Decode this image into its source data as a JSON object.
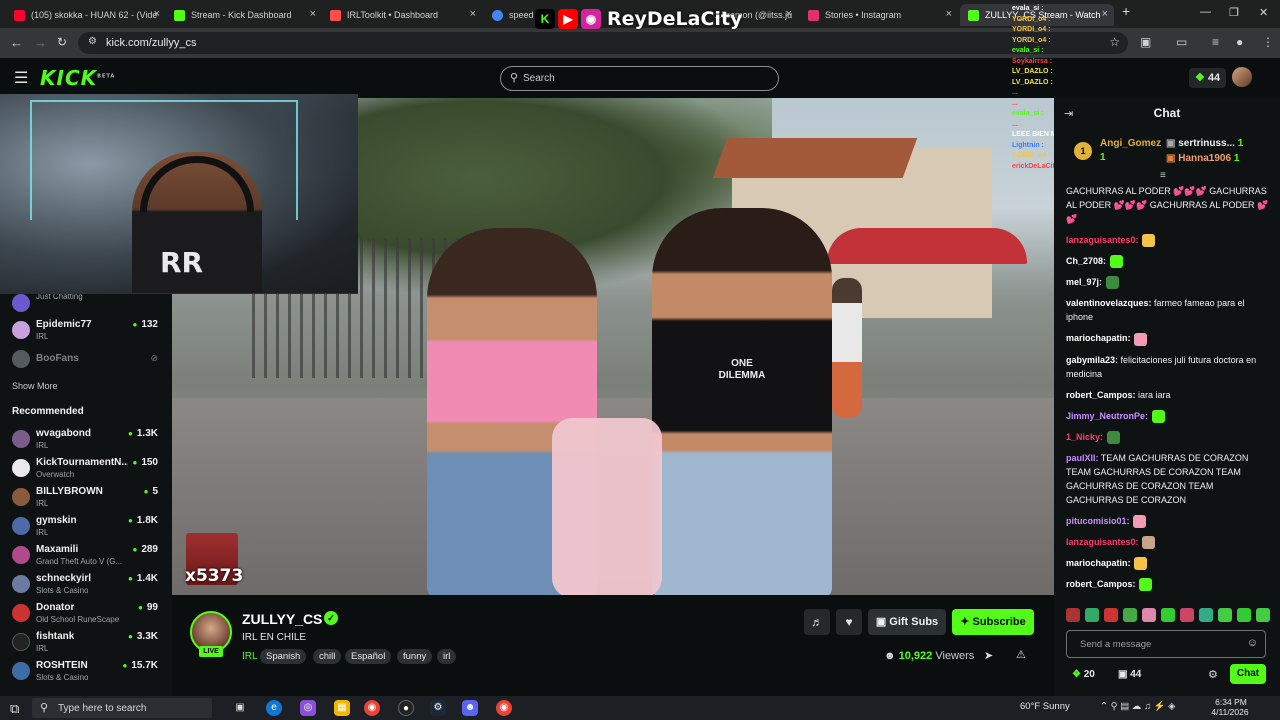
{
  "browser": {
    "tabs": [
      {
        "title": "(105) skokka - HUAN 62 - (Vide",
        "icon_color": "#ff0033"
      },
      {
        "title": "Stream - Kick Dashboard",
        "icon_color": "#53fc18"
      },
      {
        "title": "IRLToolkit • Dashboard",
        "icon_color": "#ff4d4d"
      },
      {
        "title": "speed t",
        "icon_color": "#4285f4"
      },
      {
        "title": "...lizamon (@iitss.ju",
        "icon_color": "#e1306c"
      },
      {
        "title": "Stories • Instagram",
        "icon_color": "#e1306c"
      },
      {
        "title": "ZULLYY_CS Stream - Watch",
        "icon_color": "#53fc18"
      }
    ],
    "url": "kick.com/zullyy_cs",
    "new_tab": "+",
    "close": "×"
  },
  "overlay": {
    "channel_name": "ReyDeLaCity",
    "chat_lines": [
      {
        "text": "evala_si :",
        "color": "#ffffff"
      },
      {
        "text": "YORDI_o4 :",
        "color": "#f5c542"
      },
      {
        "text": "YORDI_o4 :",
        "color": "#f5c542"
      },
      {
        "text": "YORDI_o4 :",
        "color": "#f5c542"
      },
      {
        "text": "evala_si :",
        "color": "#53fc18"
      },
      {
        "text": "Soykalrrsa :",
        "color": "#ff4040"
      },
      {
        "text": "LV_DAZLO :",
        "color": "#f5e642"
      },
      {
        "text": "LV_DAZLO :",
        "color": "#f5e642"
      },
      {
        "text": "...",
        "color": "#ff4040"
      },
      {
        "text": "...",
        "color": "#ff4040"
      },
      {
        "text": "evala_si :",
        "color": "#53fc18"
      },
      {
        "text": "...",
        "color": "#ff4040"
      },
      {
        "text": "LEEE BIEN MMG",
        "color": "#ffffff"
      },
      {
        "text": "Lightnin :",
        "color": "#3a7bff"
      },
      {
        "text": "YORDI_o4 :",
        "color": "#f5c542"
      },
      {
        "text": "erickDeLaCity :",
        "color": "#ff4040"
      }
    ]
  },
  "header": {
    "logo": "KICK",
    "logo_sup": "BETA",
    "search_placeholder": "Search",
    "points": "44"
  },
  "sidebar": {
    "following": [
      {
        "name": "Just Chatting",
        "category": "",
        "viewers": "",
        "avatar": "#6a5acd"
      },
      {
        "name": "Epidemic77",
        "category": "IRL",
        "viewers": "132",
        "avatar": "#c9a0dc"
      },
      {
        "name": "BooFans",
        "category": "",
        "viewers": "",
        "avatar": "#555a5e"
      }
    ],
    "show_more": "Show More",
    "recommended_heading": "Recommended",
    "recommended": [
      {
        "name": "wvagabond",
        "category": "IRL",
        "viewers": "1.3K",
        "avatar": "#7b5a8c"
      },
      {
        "name": "KickTournamentN...",
        "category": "Overwatch",
        "viewers": "150",
        "avatar": "#eaeaea"
      },
      {
        "name": "BILLYBROWN",
        "category": "IRL",
        "viewers": "5",
        "avatar": "#8a5a3c"
      },
      {
        "name": "gymskin",
        "category": "IRL",
        "viewers": "1.8K",
        "avatar": "#4a6aa8"
      },
      {
        "name": "Maxamili",
        "category": "Grand Theft Auto V (G...",
        "viewers": "289",
        "avatar": "#b04a8a"
      },
      {
        "name": "schneckyirl",
        "category": "Slots & Casino",
        "viewers": "1.4K",
        "avatar": "#6a7aa0"
      },
      {
        "name": "Donator",
        "category": "Old School RuneScape",
        "viewers": "99",
        "avatar": "#c33"
      },
      {
        "name": "fishtank",
        "category": "IRL",
        "viewers": "3.3K",
        "avatar": "#222"
      },
      {
        "name": "ROSHTEIN",
        "category": "Slots & Casino",
        "viewers": "15.7K",
        "avatar": "#3b6ea5"
      }
    ]
  },
  "video": {
    "shirt_text": "ONE DILEMMA",
    "emote_count": "x5373"
  },
  "stream": {
    "streamer": "ZULLYY_CS",
    "live": "LIVE",
    "title": "IRL EN CHILE",
    "category": "IRL",
    "tags": [
      "Spanish",
      "chill",
      "Español",
      "funny",
      "irl"
    ],
    "gift_subs": "Gift Subs",
    "subscribe": "Subscribe",
    "viewers": "10,922",
    "viewers_label": "Viewers"
  },
  "chat": {
    "title": "Chat",
    "gifters": [
      {
        "rank": "1",
        "name": "Angi_Gomez",
        "count": "1"
      },
      {
        "rank": "",
        "name": "sertrinuss...",
        "count": "1"
      },
      {
        "rank": "",
        "name": "Hanna1906",
        "count": "1"
      }
    ],
    "messages": [
      {
        "user": "",
        "color": "#ffffff",
        "text": "GACHURRAS AL PODER 💕💕💕 GACHURRAS AL PODER 💕💕💕 GACHURRAS AL PODER 💕💕"
      },
      {
        "user": "lanzaguisantes0:",
        "color": "#ff3b6b",
        "text": ""
      },
      {
        "user": "Ch_2708:",
        "color": "#ffffff",
        "text": ""
      },
      {
        "user": "mel_97j:",
        "color": "#ffffff",
        "text": ""
      },
      {
        "user": "valentinovelazques:",
        "color": "#ffffff",
        "text": "farmeo fameao para el iphone"
      },
      {
        "user": "mariochapatin:",
        "color": "#ffffff",
        "text": ""
      },
      {
        "user": "gabymila23:",
        "color": "#ffffff",
        "text": "felicitaciones juli futura doctora en medicina"
      },
      {
        "user": "robert_Campos:",
        "color": "#ffffff",
        "text": "iara iara"
      },
      {
        "user": "Jimmy_NeutronPe:",
        "color": "#c58cff",
        "text": ""
      },
      {
        "user": "1_Nicky:",
        "color": "#ff3b6b",
        "text": ""
      },
      {
        "user": "paulXll:",
        "color": "#c58cff",
        "text": "TEAM GACHURRAS DE CORAZON TEAM GACHURRAS DE CORAZON TEAM GACHURRAS DE CORAZON TEAM GACHURRAS DE CORAZON"
      },
      {
        "user": "pitucomisio01:",
        "color": "#c58cff",
        "text": ""
      },
      {
        "user": "lanzaguisantes0:",
        "color": "#ff3b6b",
        "text": ""
      },
      {
        "user": "mariochapatin:",
        "color": "#ffffff",
        "text": ""
      },
      {
        "user": "robert_Campos:",
        "color": "#ffffff",
        "text": ""
      }
    ],
    "input_placeholder": "Send a message",
    "points": "20",
    "subs": "44",
    "send": "Chat"
  },
  "taskbar": {
    "search_placeholder": "Type here to search",
    "weather": "60°F  Sunny",
    "time": "6:34 PM",
    "date": "4/11/2026"
  }
}
